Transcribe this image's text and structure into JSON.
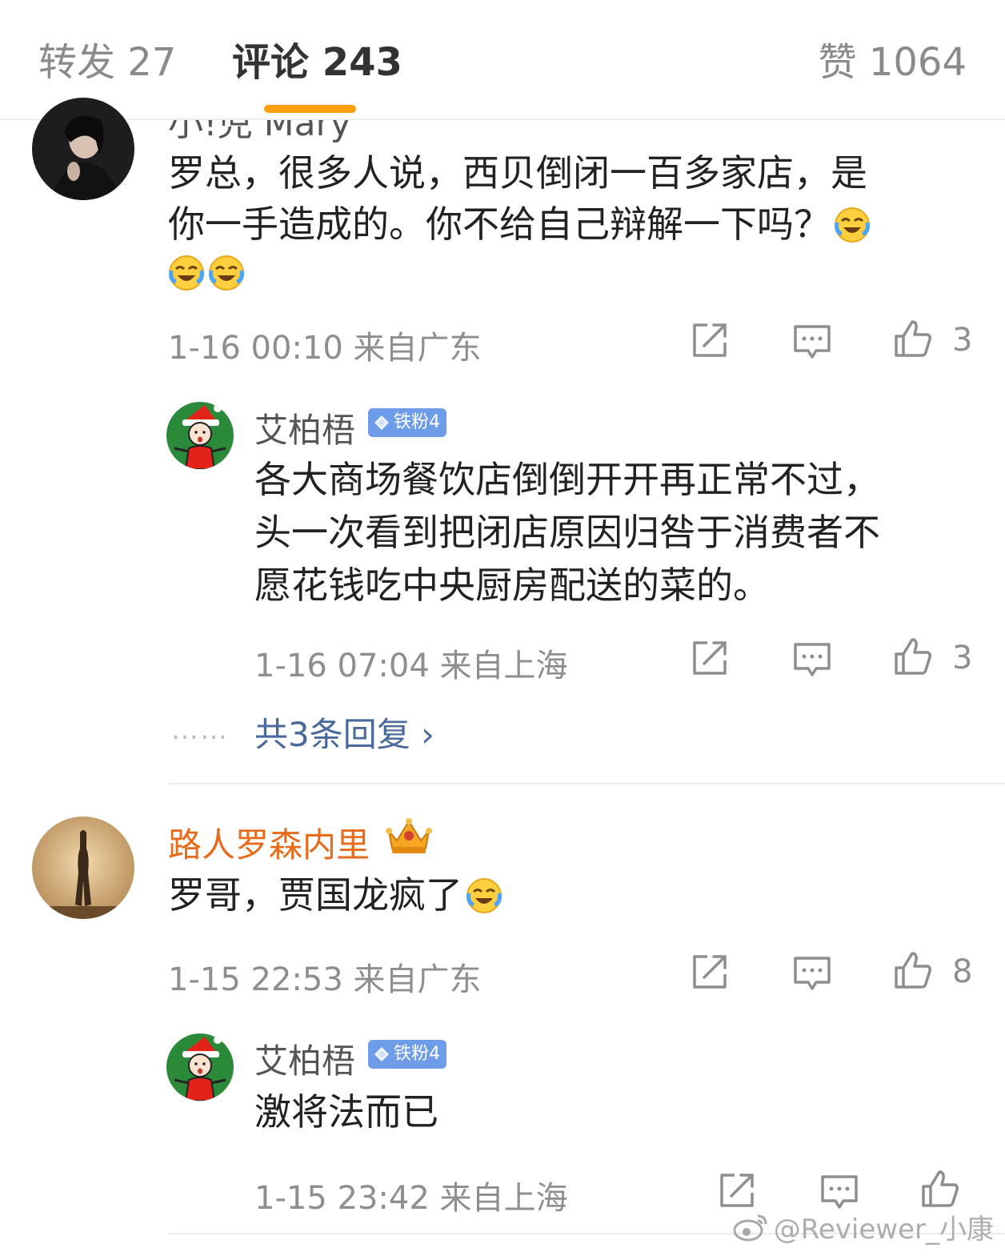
{
  "tabs": {
    "repost": "转发 27",
    "comment": "评论 243",
    "like": "赞 1064"
  },
  "comments": [
    {
      "user": {
        "name_partial": "小!児 Mary"
      },
      "text_line1": "罗总，很多人说，西贝倒闭一百多家店，是",
      "text_line2": "你一手造成的。你不给自己辩解一下吗？",
      "emoji": "laugh-cry-emoji",
      "meta": "1-16 00:10 来自广东",
      "like_count": "3",
      "reply": {
        "user": {
          "name": "艾柏梧",
          "badge": "铁粉4"
        },
        "lines": [
          "各大商场餐饮店倒倒开开再正常不过，",
          "头一次看到把闭店原因归咎于消费者不",
          "愿花钱吃中央厨房配送的菜的。"
        ],
        "meta": "1-16 07:04 来自上海",
        "like_count": "3"
      },
      "more_dots": "……",
      "more_replies": "共3条回复 ›"
    },
    {
      "user": {
        "name": "路人罗森内里"
      },
      "text": "罗哥，贾国龙疯了",
      "emoji": "laugh-cry-emoji",
      "meta": "1-15 22:53 来自广东",
      "like_count": "8",
      "reply": {
        "user": {
          "name": "艾柏梧",
          "badge": "铁粉4"
        },
        "text": "激将法而已",
        "meta": "1-15 23:42 来自上海",
        "like_count": ""
      }
    }
  ],
  "watermark": "@Reviewer_小康",
  "colors": {
    "accent": "#ff9f0f",
    "vip_name": "#e86b1c",
    "link": "#4a6a9c",
    "badge": "#6f9ce8"
  }
}
